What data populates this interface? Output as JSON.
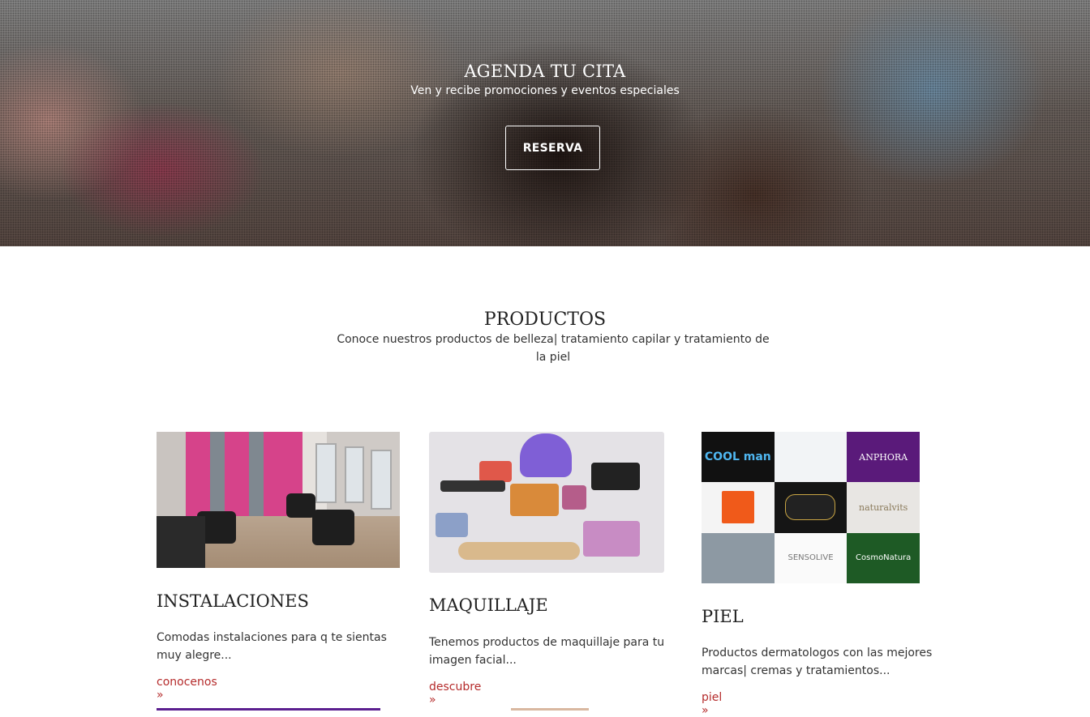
{
  "hero": {
    "title": "AGENDA TU CITA",
    "subtitle": "Ven y recibe promociones y eventos especiales",
    "button_label": "RESERVA"
  },
  "products": {
    "title": "PRODUCTOS",
    "subtitle": "Conoce nuestros productos de belleza| tratamiento capilar y tratamiento de la piel"
  },
  "cards": [
    {
      "title": "INSTALACIONES",
      "text": "Comodas instalaciones para q te sientas muy alegre...",
      "link": "conocenos »"
    },
    {
      "title": "MAQUILLAJE",
      "text": "Tenemos productos de maquillaje para tu imagen facial...",
      "link": "descubre »"
    },
    {
      "title": "PIEL",
      "text": "Productos dermatologos con las mejores marcas| cremas y tratamientos...",
      "link": "piel »"
    }
  ],
  "brands": [
    "COOL man",
    "",
    "ANPHORA",
    "",
    "",
    "naturalvits",
    "",
    "SENSOLIVE",
    "CosmoNatura"
  ],
  "colors": {
    "link": "#b52b2b",
    "accent_purple": "#5b1f8f"
  }
}
